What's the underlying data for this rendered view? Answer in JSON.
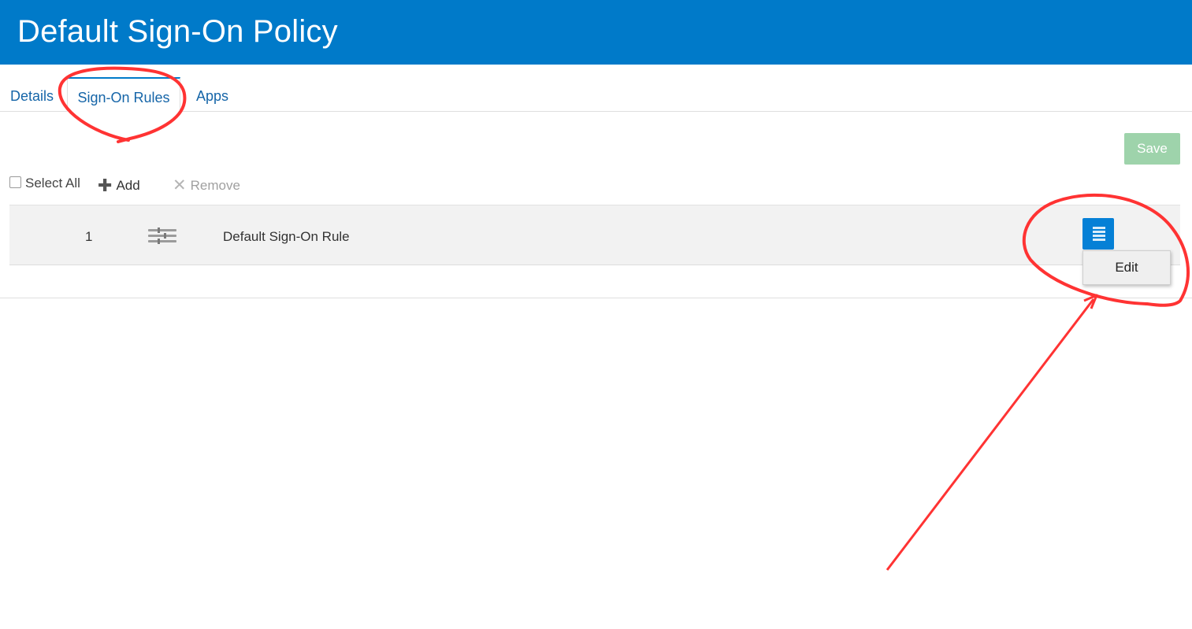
{
  "header": {
    "title": "Default Sign-On Policy"
  },
  "tabs": [
    {
      "label": "Details"
    },
    {
      "label": "Sign-On Rules",
      "active": true
    },
    {
      "label": "Apps"
    }
  ],
  "actions": {
    "save_label": "Save"
  },
  "toolbar": {
    "select_all_label": "Select All",
    "add_label": "Add",
    "remove_label": "Remove"
  },
  "rules": [
    {
      "index": "1",
      "name": "Default Sign-On Rule"
    }
  ],
  "row_menu": {
    "items": [
      {
        "label": "Edit"
      }
    ]
  },
  "colors": {
    "header": "#007ac9",
    "tab_text": "#1565a8",
    "save_disabled": "#9ed3ab",
    "menu_button": "#0580d6",
    "annotation": "#ff3333"
  },
  "icons": {
    "add": "plus-icon",
    "remove": "x-icon",
    "drag": "drag-handle-icon",
    "menu": "hamburger-menu-icon"
  }
}
